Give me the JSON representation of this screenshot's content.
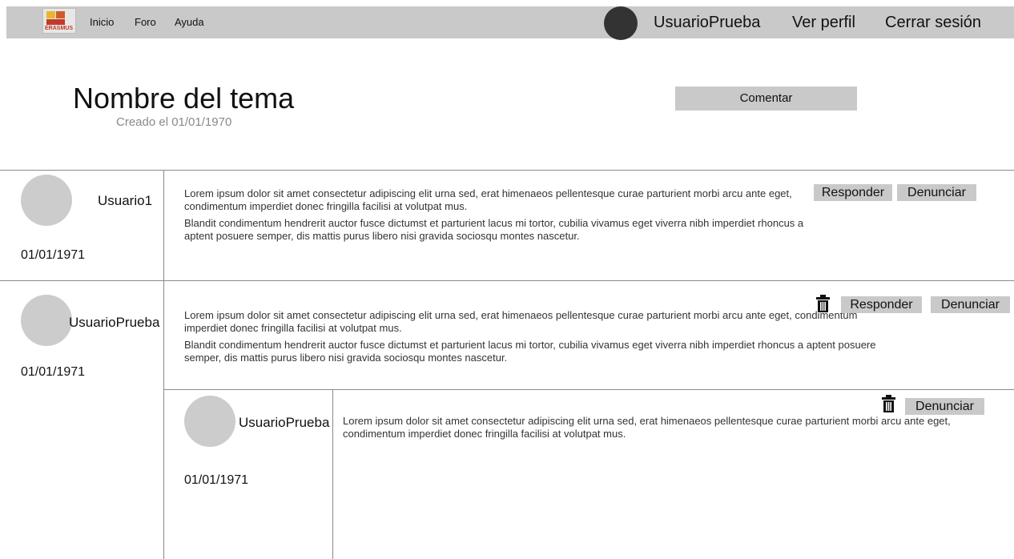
{
  "header": {
    "logo_text": "ERASMUS",
    "nav": [
      "Inicio",
      "Foro",
      "Ayuda"
    ],
    "user_name": "UsuarioPrueba",
    "profile_link": "Ver perfil",
    "logout_link": "Cerrar sesión"
  },
  "topic": {
    "title": "Nombre del tema",
    "created": "Creado el 01/01/1970",
    "comment_button": "Comentar"
  },
  "posts": [
    {
      "user": "Usuario1",
      "date": "01/01/1971",
      "paragraphs": [
        "Lorem ipsum dolor sit amet consectetur adipiscing elit urna sed, erat himenaeos pellentesque curae parturient morbi arcu ante eget, condimentum imperdiet donec fringilla facilisi at volutpat mus.",
        "Blandit condimentum hendrerit auctor fusce dictumst et parturient lacus mi tortor, cubilia vivamus eget viverra nibh imperdiet rhoncus a aptent posuere semper, dis mattis purus libero nisi gravida sociosqu montes nascetur."
      ],
      "reply_label": "Responder",
      "report_label": "Denunciar"
    },
    {
      "user": "UsuarioPrueba",
      "date": "01/01/1971",
      "paragraphs": [
        "Lorem ipsum dolor sit amet consectetur adipiscing elit urna sed, erat himenaeos pellentesque curae parturient morbi arcu ante eget, condimentum imperdiet donec fringilla facilisi at volutpat mus.",
        "Blandit condimentum hendrerit auctor fusce dictumst et parturient lacus mi tortor, cubilia vivamus eget viverra nibh imperdiet rhoncus a aptent posuere semper, dis mattis purus libero nisi gravida sociosqu montes nascetur."
      ],
      "reply_label": "Responder",
      "report_label": "Denunciar",
      "delete_icon": "trash-icon"
    }
  ],
  "reply": {
    "user": "UsuarioPrueba",
    "date": "01/01/1971",
    "text": "Lorem ipsum dolor sit amet consectetur adipiscing elit urna sed, erat himenaeos pellentesque curae parturient morbi arcu ante eget, condimentum imperdiet donec fringilla facilisi at volutpat mus.",
    "report_label": "Denunciar",
    "delete_icon": "trash-icon"
  },
  "colors": {
    "bar": "#c9c9c9",
    "avatar": "#cccccc",
    "user_avatar": "#333333",
    "muted_text": "#8a8a8a"
  }
}
